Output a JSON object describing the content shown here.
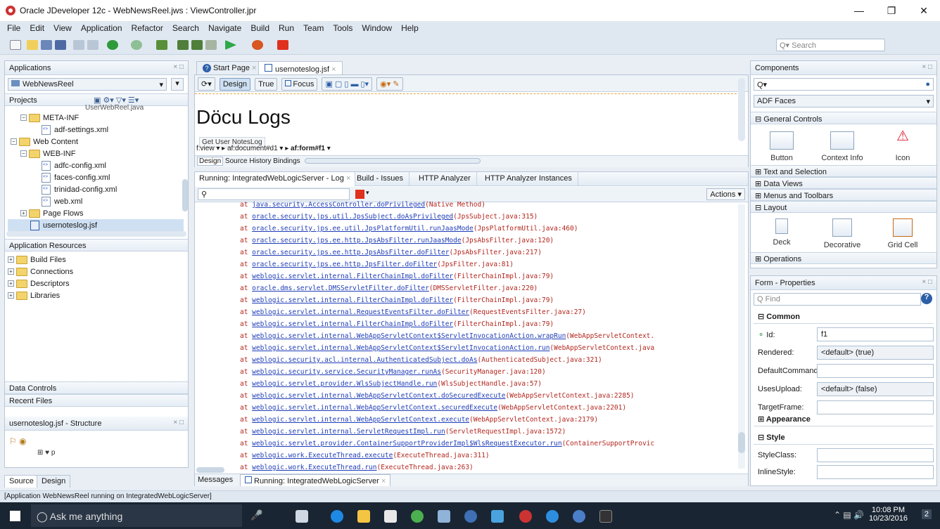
{
  "window": {
    "title": "Oracle JDeveloper 12c - WebNewsReel.jws : ViewController.jpr"
  },
  "menu": [
    "File",
    "Edit",
    "View",
    "Application",
    "Refactor",
    "Search",
    "Navigate",
    "Build",
    "Run",
    "Team",
    "Tools",
    "Window",
    "Help"
  ],
  "toolbar": {
    "search_placeholder": "Search"
  },
  "applications": {
    "title": "Applications",
    "app_name": "WebNewsReel",
    "projects_label": "Projects",
    "tree": [
      {
        "label": "UserWebReel.java",
        "level": 4,
        "type": "file"
      },
      {
        "label": "META-INF",
        "level": 1,
        "type": "folder"
      },
      {
        "label": "adf-settings.xml",
        "level": 3,
        "type": "xml"
      },
      {
        "label": "Web Content",
        "level": 0,
        "type": "folder"
      },
      {
        "label": "WEB-INF",
        "level": 1,
        "type": "folder"
      },
      {
        "label": "adfc-config.xml",
        "level": 3,
        "type": "xml"
      },
      {
        "label": "faces-config.xml",
        "level": 3,
        "type": "xml"
      },
      {
        "label": "trinidad-config.xml",
        "level": 3,
        "type": "xml"
      },
      {
        "label": "web.xml",
        "level": 3,
        "type": "xml"
      },
      {
        "label": "Page Flows",
        "level": 1,
        "type": "folder"
      },
      {
        "label": "usernoteslog.jsf",
        "level": 1,
        "type": "jsf"
      }
    ],
    "resources_label": "Application Resources",
    "resources": [
      "Build Files",
      "Connections",
      "Descriptors",
      "Libraries"
    ],
    "data_controls": "Data Controls",
    "recent_files": "Recent Files"
  },
  "structure": {
    "title": "usernoteslog.jsf - Structure",
    "tabs": [
      "Source",
      "Design"
    ],
    "node": "p"
  },
  "editor": {
    "tabs": [
      "Start Page",
      "usernoteslog.jsf"
    ],
    "toolbar": [
      "Design",
      "True",
      "Focus"
    ],
    "heading": "Döcu Logs",
    "button": "Get User NotesLog",
    "breadcrumb": [
      "f:view",
      "af:document#d1",
      "af:form#f1"
    ],
    "bottom_tabs": [
      "Design",
      "Source",
      "History",
      "Bindings"
    ]
  },
  "log": {
    "tabs": [
      "Running: IntegratedWebLogicServer - Log",
      "Build - Issues",
      "HTTP Analyzer",
      "HTTP Analyzer Instances"
    ],
    "actions": "Actions",
    "lines": [
      {
        "m": "java.security.AccessController.doPrivileged",
        "s": "(Native Method)"
      },
      {
        "m": "oracle.security.jps.util.JpsSubject.doAsPrivileged",
        "s": "(JpsSubject.java:315)"
      },
      {
        "m": "oracle.security.jps.ee.util.JpsPlatformUtil.runJaasMode",
        "s": "(JpsPlatformUtil.java:460)"
      },
      {
        "m": "oracle.security.jps.ee.http.JpsAbsFilter.runJaasMode",
        "s": "(JpsAbsFilter.java:120)"
      },
      {
        "m": "oracle.security.jps.ee.http.JpsAbsFilter.doFilter",
        "s": "(JpsAbsFilter.java:217)"
      },
      {
        "m": "oracle.security.jps.ee.http.JpsFilter.doFilter",
        "s": "(JpsFilter.java:81)"
      },
      {
        "m": "weblogic.servlet.internal.FilterChainImpl.doFilter",
        "s": "(FilterChainImpl.java:79)"
      },
      {
        "m": "oracle.dms.servlet.DMSServletFilter.doFilter",
        "s": "(DMSServletFilter.java:220)"
      },
      {
        "m": "weblogic.servlet.internal.FilterChainImpl.doFilter",
        "s": "(FilterChainImpl.java:79)"
      },
      {
        "m": "weblogic.servlet.internal.RequestEventsFilter.doFilter",
        "s": "(RequestEventsFilter.java:27)"
      },
      {
        "m": "weblogic.servlet.internal.FilterChainImpl.doFilter",
        "s": "(FilterChainImpl.java:79)"
      },
      {
        "m": "weblogic.servlet.internal.WebAppServletContext$ServletInvocationAction.wrapRun",
        "s": "(WebAppServletContext."
      },
      {
        "m": "weblogic.servlet.internal.WebAppServletContext$ServletInvocationAction.run",
        "s": "(WebAppServletContext.java"
      },
      {
        "m": "weblogic.security.acl.internal.AuthenticatedSubject.doAs",
        "s": "(AuthenticatedSubject.java:321)"
      },
      {
        "m": "weblogic.security.service.SecurityManager.runAs",
        "s": "(SecurityManager.java:120)"
      },
      {
        "m": "weblogic.servlet.provider.WlsSubjectHandle.run",
        "s": "(WlsSubjectHandle.java:57)"
      },
      {
        "m": "weblogic.servlet.internal.WebAppServletContext.doSecuredExecute",
        "s": "(WebAppServletContext.java:2285)"
      },
      {
        "m": "weblogic.servlet.internal.WebAppServletContext.securedExecute",
        "s": "(WebAppServletContext.java:2201)"
      },
      {
        "m": "weblogic.servlet.internal.WebAppServletContext.execute",
        "s": "(WebAppServletContext.java:2179)"
      },
      {
        "m": "weblogic.servlet.internal.ServletRequestImpl.run",
        "s": "(ServletRequestImpl.java:1572)"
      },
      {
        "m": "weblogic.servlet.provider.ContainerSupportProviderImpl$WlsRequestExecutor.run",
        "s": "(ContainerSupportProvic"
      },
      {
        "m": "weblogic.work.ExecuteThread.execute",
        "s": "(ExecuteThread.java:311)"
      },
      {
        "m": "weblogic.work.ExecuteThread.run",
        "s": "(ExecuteThread.java:263)"
      }
    ],
    "bottom_tabs": [
      "Messages",
      "Running: IntegratedWebLogicServer"
    ]
  },
  "components": {
    "title": "Components",
    "library": "ADF Faces",
    "general": "General Controls",
    "items1": [
      "Button",
      "Context Info",
      "Icon"
    ],
    "cats": [
      "Text and Selection",
      "Data Views",
      "Menus and Toolbars",
      "Layout"
    ],
    "items2": [
      "Deck",
      "Decorative",
      "Grid Cell"
    ],
    "ops": "Operations"
  },
  "properties": {
    "title": "Form - Properties",
    "find_placeholder": "Find",
    "common": "Common",
    "fields": [
      {
        "label": "Id:",
        "value": "f1"
      },
      {
        "label": "Rendered:",
        "value": "<default> (true)"
      },
      {
        "label": "DefaultCommand:",
        "value": ""
      },
      {
        "label": "UsesUpload:",
        "value": "<default> (false)"
      },
      {
        "label": "TargetFrame:",
        "value": ""
      }
    ],
    "appearance": "Appearance",
    "style": "Style",
    "style_fields": [
      {
        "label": "StyleClass:",
        "value": ""
      },
      {
        "label": "InlineStyle:",
        "value": ""
      }
    ]
  },
  "status": "[Application WebNewsReel running on IntegratedWebLogicServer]",
  "taskbar": {
    "search": "Ask me anything",
    "time": "10:08 PM",
    "date": "10/23/2016",
    "notif": "2"
  }
}
